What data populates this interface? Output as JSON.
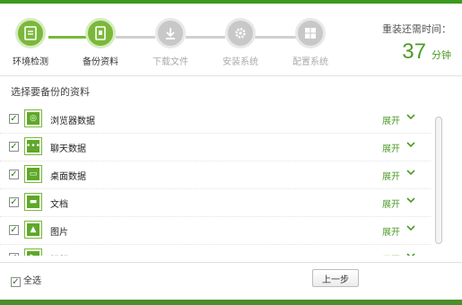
{
  "steps": [
    {
      "label": "环境检测",
      "state": "done",
      "icon": "monitor-icon"
    },
    {
      "label": "备份资料",
      "state": "active",
      "icon": "document-icon"
    },
    {
      "label": "下载文件",
      "state": "pending",
      "icon": "download-icon"
    },
    {
      "label": "安装系统",
      "state": "pending",
      "icon": "gear-icon"
    },
    {
      "label": "配置系统",
      "state": "pending",
      "icon": "windows-icon"
    }
  ],
  "timer": {
    "title": "重装还需时间：",
    "value": "37",
    "unit": "分钟"
  },
  "section_title": "选择要备份的资料",
  "items": [
    {
      "label": "浏览器数据",
      "checked": true,
      "icon": "globe-icon",
      "action": "展开"
    },
    {
      "label": "聊天数据",
      "checked": true,
      "icon": "chat-icon",
      "action": "展开"
    },
    {
      "label": "桌面数据",
      "checked": true,
      "icon": "desktop-icon",
      "action": "展开"
    },
    {
      "label": "文档",
      "checked": true,
      "icon": "folder-icon",
      "action": "展开"
    },
    {
      "label": "图片",
      "checked": true,
      "icon": "image-icon",
      "action": "展开"
    },
    {
      "label": "视频",
      "checked": true,
      "icon": "video-icon",
      "action": "展开"
    }
  ],
  "footer": {
    "select_all": "全选",
    "select_all_checked": true,
    "prev_button": "上一步"
  },
  "colors": {
    "accent": "#4c9b26",
    "step_done": "#7bb83a",
    "step_pending": "#c8c8c8"
  }
}
